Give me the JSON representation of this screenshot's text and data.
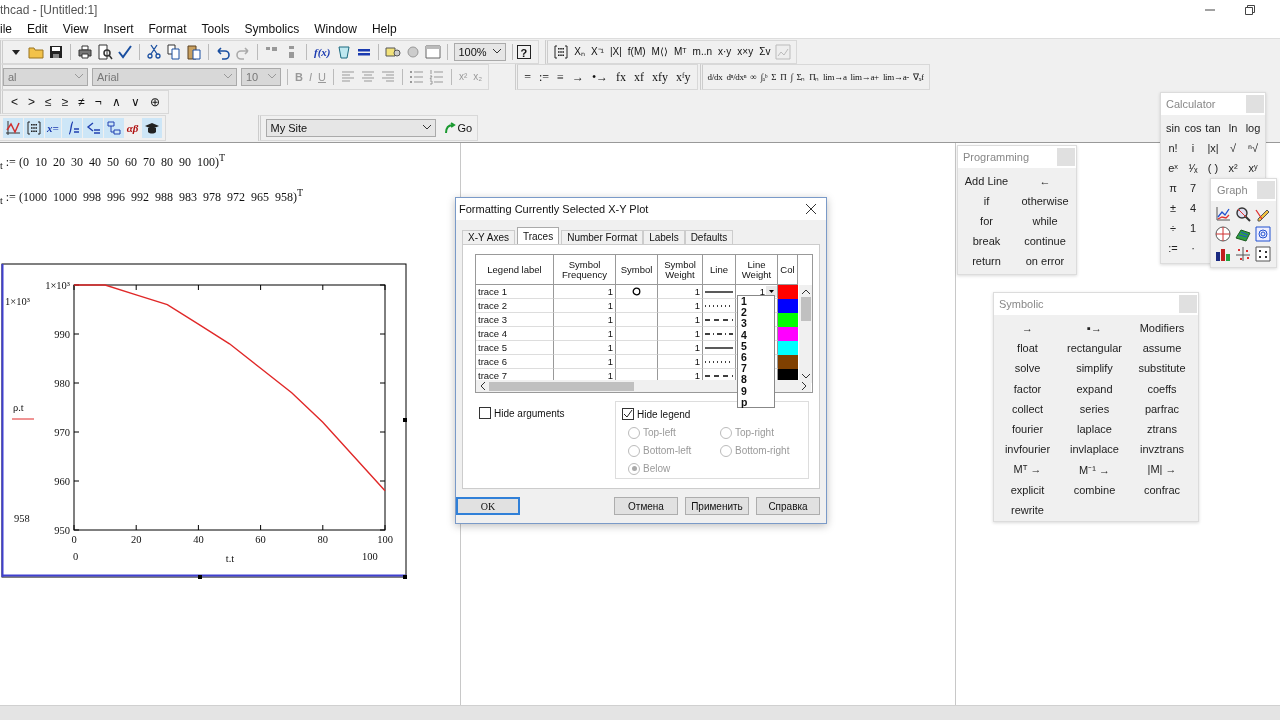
{
  "window": {
    "title": "thcad - [Untitled:1]"
  },
  "menu": [
    "ile",
    "Edit",
    "View",
    "Insert",
    "Format",
    "Tools",
    "Symbolics",
    "Window",
    "Help"
  ],
  "toolbars": {
    "function": "f(x)",
    "zoom": "100%",
    "help": "?",
    "matrix": [
      "Xₙ",
      "X⁻¹",
      "|X|",
      "f(M)",
      "M⟨⟩",
      "Mᵀ",
      "m..n",
      "x·y",
      "x×y",
      "Σv"
    ],
    "style": "al",
    "font": "Arial",
    "size": "10",
    "format_buttons": [
      "B",
      "I",
      "U"
    ],
    "sub_super": [
      "x²",
      "x₂"
    ],
    "evaluation": [
      "=",
      ":=",
      "≡",
      "→",
      "•→",
      "fx",
      "xf",
      "xfy",
      "xᶠy"
    ],
    "calculus": [
      "d/dx",
      "dⁿ/dxⁿ",
      "∞",
      "∫ₐᵇ",
      "Σ",
      "Π",
      "∫",
      "Σₙ",
      "Πₙ",
      "lim→a",
      "lim→a+",
      "lim→a-",
      "∇ₓf"
    ],
    "boolean": [
      "<",
      ">",
      "≤",
      "≥",
      "≠",
      "¬",
      "∧",
      "∨",
      "⊕"
    ],
    "math": [
      {
        "kind": "graph",
        "on": true
      },
      {
        "kind": "matrix",
        "on": true
      },
      {
        "kind": "evaluation",
        "text": "x=",
        "on": true
      },
      {
        "kind": "calculus",
        "on": true
      },
      {
        "kind": "boolean",
        "on": true
      },
      {
        "kind": "programming",
        "on": true
      },
      {
        "kind": "greek",
        "text": "αβ",
        "on": false
      },
      {
        "kind": "symbolic",
        "on": true
      }
    ],
    "resource": {
      "value": "My Site",
      "go": "Go"
    }
  },
  "worksheet": {
    "definitions": [
      "$_{t}$ := (0  10  20  30  40  50  60  70  80  90  100)$^{T}$",
      "$_{t}$ := (1000  1000  998  996  992  988  983  978  972  965  958)$^{T}$"
    ]
  },
  "plot": {
    "limits": {
      "y_max": "1×10³",
      "y_min": "958",
      "x_min": "0",
      "x_max": "100"
    },
    "chart_data": {
      "type": "line",
      "xlabel": "t.t",
      "x": [
        0,
        10,
        20,
        30,
        40,
        50,
        60,
        70,
        80,
        90,
        100
      ],
      "series": [
        {
          "name": "ρ.t",
          "color": "#e02828",
          "values": [
            1000,
            1000,
            998,
            996,
            992,
            988,
            983,
            978,
            972,
            965,
            958
          ]
        }
      ],
      "xlim": [
        0,
        100
      ],
      "ylim": [
        950,
        1000
      ],
      "xticks": [
        0,
        20,
        40,
        60,
        80,
        100
      ],
      "yticks": [
        950,
        960,
        970,
        980,
        990,
        {
          "value": 1000,
          "label": "1×10³"
        }
      ]
    }
  },
  "dialog": {
    "title": "Formatting Currently Selected X-Y Plot",
    "tabs": [
      {
        "label": "X-Y Axes",
        "selected": false
      },
      {
        "label": "Traces",
        "selected": true
      },
      {
        "label": "Number Format",
        "selected": false
      },
      {
        "label": "Labels",
        "selected": false
      },
      {
        "label": "Defaults",
        "selected": false
      }
    ],
    "columns": [
      "Legend label",
      "Symbol Frequency",
      "Symbol",
      "Symbol Weight",
      "Line",
      "Line Weight",
      "Col"
    ],
    "rows": [
      {
        "label": "trace 1",
        "frequency": "1",
        "symbol": {
          "kind": "circle"
        },
        "symbol_weight": "1",
        "line": {
          "kind": "solid"
        },
        "line_weight": "1",
        "color": "#ff0000"
      },
      {
        "label": "trace 2",
        "frequency": "1",
        "symbol_weight": "1",
        "line": {
          "kind": "dot"
        },
        "color": "#0000ff"
      },
      {
        "label": "trace 3",
        "frequency": "1",
        "symbol_weight": "1",
        "line": {
          "kind": "dash"
        },
        "color": "#00ff00"
      },
      {
        "label": "trace 4",
        "frequency": "1",
        "symbol_weight": "1",
        "line": {
          "kind": "dadot"
        },
        "color": "#ff00ff"
      },
      {
        "label": "trace 5",
        "frequency": "1",
        "symbol_weight": "1",
        "line": {
          "kind": "solid"
        },
        "color": "#00ffff"
      },
      {
        "label": "trace 6",
        "frequency": "1",
        "symbol_weight": "1",
        "line": {
          "kind": "dot"
        },
        "color": "#804000"
      },
      {
        "label": "trace 7",
        "frequency": "1",
        "symbol_weight": "1",
        "line": {
          "kind": "dash"
        },
        "color": "#000000"
      }
    ],
    "dropdown": [
      "1",
      "2",
      "3",
      "4",
      "5",
      "6",
      "7",
      "8",
      "9",
      "p"
    ],
    "hide_arguments": {
      "label": "Hide arguments",
      "checked": false
    },
    "hide_legend": {
      "label": "Hide legend",
      "checked": true
    },
    "positions": [
      {
        "label": "Top-left",
        "selected": false,
        "disabled": true
      },
      {
        "label": "Top-right",
        "selected": false,
        "disabled": true
      },
      {
        "label": "Bottom-left",
        "selected": false,
        "disabled": true
      },
      {
        "label": "Bottom-right",
        "selected": false,
        "disabled": true
      },
      {
        "label": "Below",
        "selected": true,
        "disabled": true
      }
    ],
    "buttons": [
      {
        "label": "OK",
        "default": true
      },
      {
        "label": "Отмена",
        "default": false
      },
      {
        "label": "Применить",
        "default": false
      },
      {
        "label": "Справка",
        "default": false
      }
    ]
  },
  "programming": {
    "title": "Programming",
    "items": [
      "Add Line",
      "←",
      "if",
      "otherwise",
      "for",
      "while",
      "break",
      "continue",
      "return",
      "on error"
    ]
  },
  "calculator": {
    "title": "Calculator",
    "rows": [
      [
        "sin",
        "cos",
        "tan",
        "ln",
        "log"
      ],
      [
        "n!",
        "i",
        "|x|",
        "√",
        "ⁿ√"
      ],
      [
        "eˣ",
        "¹⁄ₓ",
        "( )",
        "x²",
        "xʸ"
      ],
      [
        "π",
        "7"
      ],
      [
        "±",
        "4"
      ],
      [
        "÷",
        "1"
      ],
      [
        ":=",
        "·"
      ]
    ]
  },
  "graph": {
    "title": "Graph"
  },
  "symbolic": {
    "title": "Symbolic",
    "items": [
      "→",
      "▪→",
      "Modifiers",
      "float",
      "rectangular",
      "assume",
      "solve",
      "simplify",
      "substitute",
      "factor",
      "expand",
      "coeffs",
      "collect",
      "series",
      "parfrac",
      "fourier",
      "laplace",
      "ztrans",
      "invfourier",
      "invlaplace",
      "invztrans",
      "Mᵀ →",
      "M⁻¹ →",
      "|M| →",
      "explicit",
      "combine",
      "confrac",
      "rewrite"
    ]
  }
}
